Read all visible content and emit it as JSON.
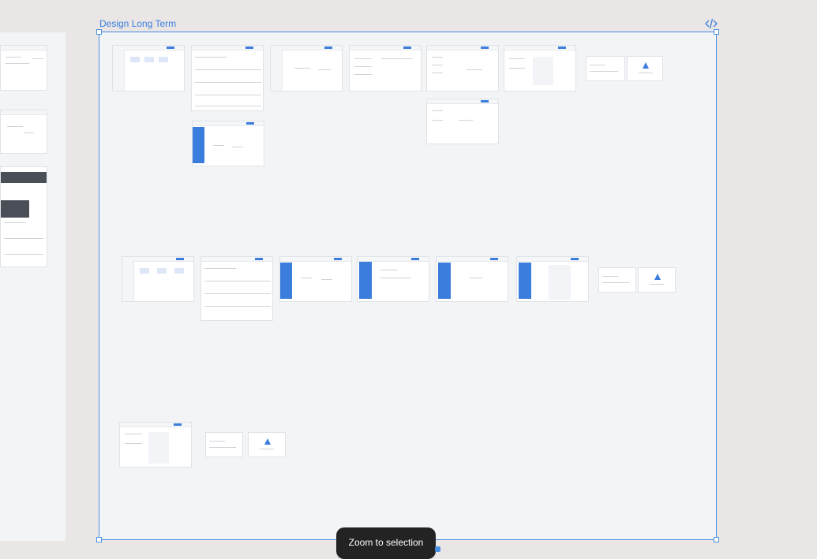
{
  "frame": {
    "name": "Design Long Term"
  },
  "tooltip": {
    "label": "Zoom to selection"
  },
  "icons": {
    "code": "code-icon"
  },
  "colors": {
    "canvas": "#e9e6e5",
    "frame_fill": "#f3f4f6",
    "selection": "#4a90e2",
    "accent": "#3b7ddd",
    "tooltip_bg": "#232323"
  }
}
